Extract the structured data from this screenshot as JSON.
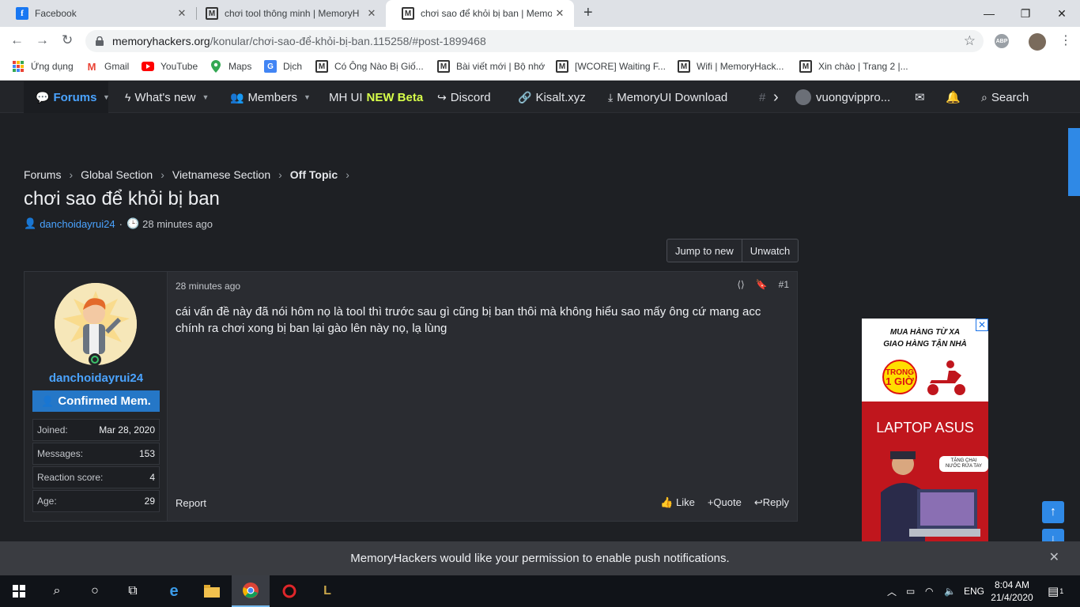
{
  "browser": {
    "tabs": [
      {
        "title": "Facebook",
        "icon": "facebook-icon",
        "active": false
      },
      {
        "title": "chơi tool thông minh | MemoryH",
        "icon": "memoryhackers-icon",
        "active": false
      },
      {
        "title": "chơi sao để khỏi bị ban | Memory",
        "icon": "memoryhackers-icon",
        "active": true
      }
    ],
    "url_host": "memoryhackers.org",
    "url_path": "/konular/chơi-sao-để-khỏi-bị-ban.115258/#post-1899468",
    "abp_label": "ABP",
    "bookmarks": [
      {
        "label": "Ứng dụng",
        "icon": "apps-grid-icon"
      },
      {
        "label": "Gmail",
        "icon": "gmail-icon"
      },
      {
        "label": "YouTube",
        "icon": "youtube-icon"
      },
      {
        "label": "Maps",
        "icon": "maps-icon"
      },
      {
        "label": "Dịch",
        "icon": "translate-icon"
      },
      {
        "label": "Có Ông Nào Bị Giố...",
        "icon": "memoryhackers-icon"
      },
      {
        "label": "Bài viết mới | Bộ nhớ",
        "icon": "memoryhackers-icon"
      },
      {
        "label": "[WCORE] Waiting F...",
        "icon": "memoryhackers-icon"
      },
      {
        "label": "Wifi | MemoryHack...",
        "icon": "memoryhackers-icon"
      },
      {
        "label": "Xin chào | Trang 2 |...",
        "icon": "memoryhackers-icon"
      }
    ]
  },
  "nav": {
    "forums": "Forums",
    "whats_new": "What's new",
    "members": "Members",
    "mh_ui": "MH UI",
    "new_beta": "NEW Beta",
    "discord": "Discord",
    "kisalt": "Kisalt.xyz",
    "memoryui_download": "MemoryUI Download",
    "username": "vuongvippro...",
    "search": "Search"
  },
  "breadcrumbs": [
    "Forums",
    "Global Section",
    "Vietnamese Section",
    "Off Topic"
  ],
  "thread": {
    "title": "chơi sao để khỏi bị ban",
    "author": "danchoidayrui24",
    "age": "28 minutes ago",
    "jump_to_new": "Jump to new",
    "unwatch": "Unwatch"
  },
  "post": {
    "username": "danchoidayrui24",
    "user_title": "Confirmed Mem.",
    "stats": [
      {
        "label": "Joined:",
        "value": "Mar 28, 2020"
      },
      {
        "label": "Messages:",
        "value": "153"
      },
      {
        "label": "Reaction score:",
        "value": "4"
      },
      {
        "label": "Age:",
        "value": "29"
      }
    ],
    "time": "28 minutes ago",
    "number": "#1",
    "body_line1": "cái vấn đề này đã nói hôm nọ là tool thì trước sau gì cũng bị ban thôi mà không hiểu sao mấy ông cứ mang acc",
    "body_line2": "chính ra chơi xong bị ban lại gào lên này nọ, lạ lùng",
    "report": "Report",
    "like": "Like",
    "quote": "Quote",
    "reply": "Reply"
  },
  "ad": {
    "line1": "MUA HÀNG TỪ XA",
    "line2": "GIAO HÀNG TẬN NHÀ",
    "badge_top": "TRONG",
    "badge_bottom": "1 GIỜ",
    "title": "LAPTOP ASUS",
    "bubble": "TẶNG CHAI NƯỚC RỬA TAY"
  },
  "notice": {
    "text": "MemoryHackers would like your permission to enable push notifications."
  },
  "taskbar": {
    "lang": "ENG",
    "time": "8:04 AM",
    "date": "21/4/2020",
    "notif_count": "1"
  },
  "colors": {
    "accent": "#4aa3ff",
    "banner": "#2577c7",
    "page_bg": "#1e2024",
    "post_bg": "#2a2c31",
    "ad_red": "#c0161d"
  }
}
